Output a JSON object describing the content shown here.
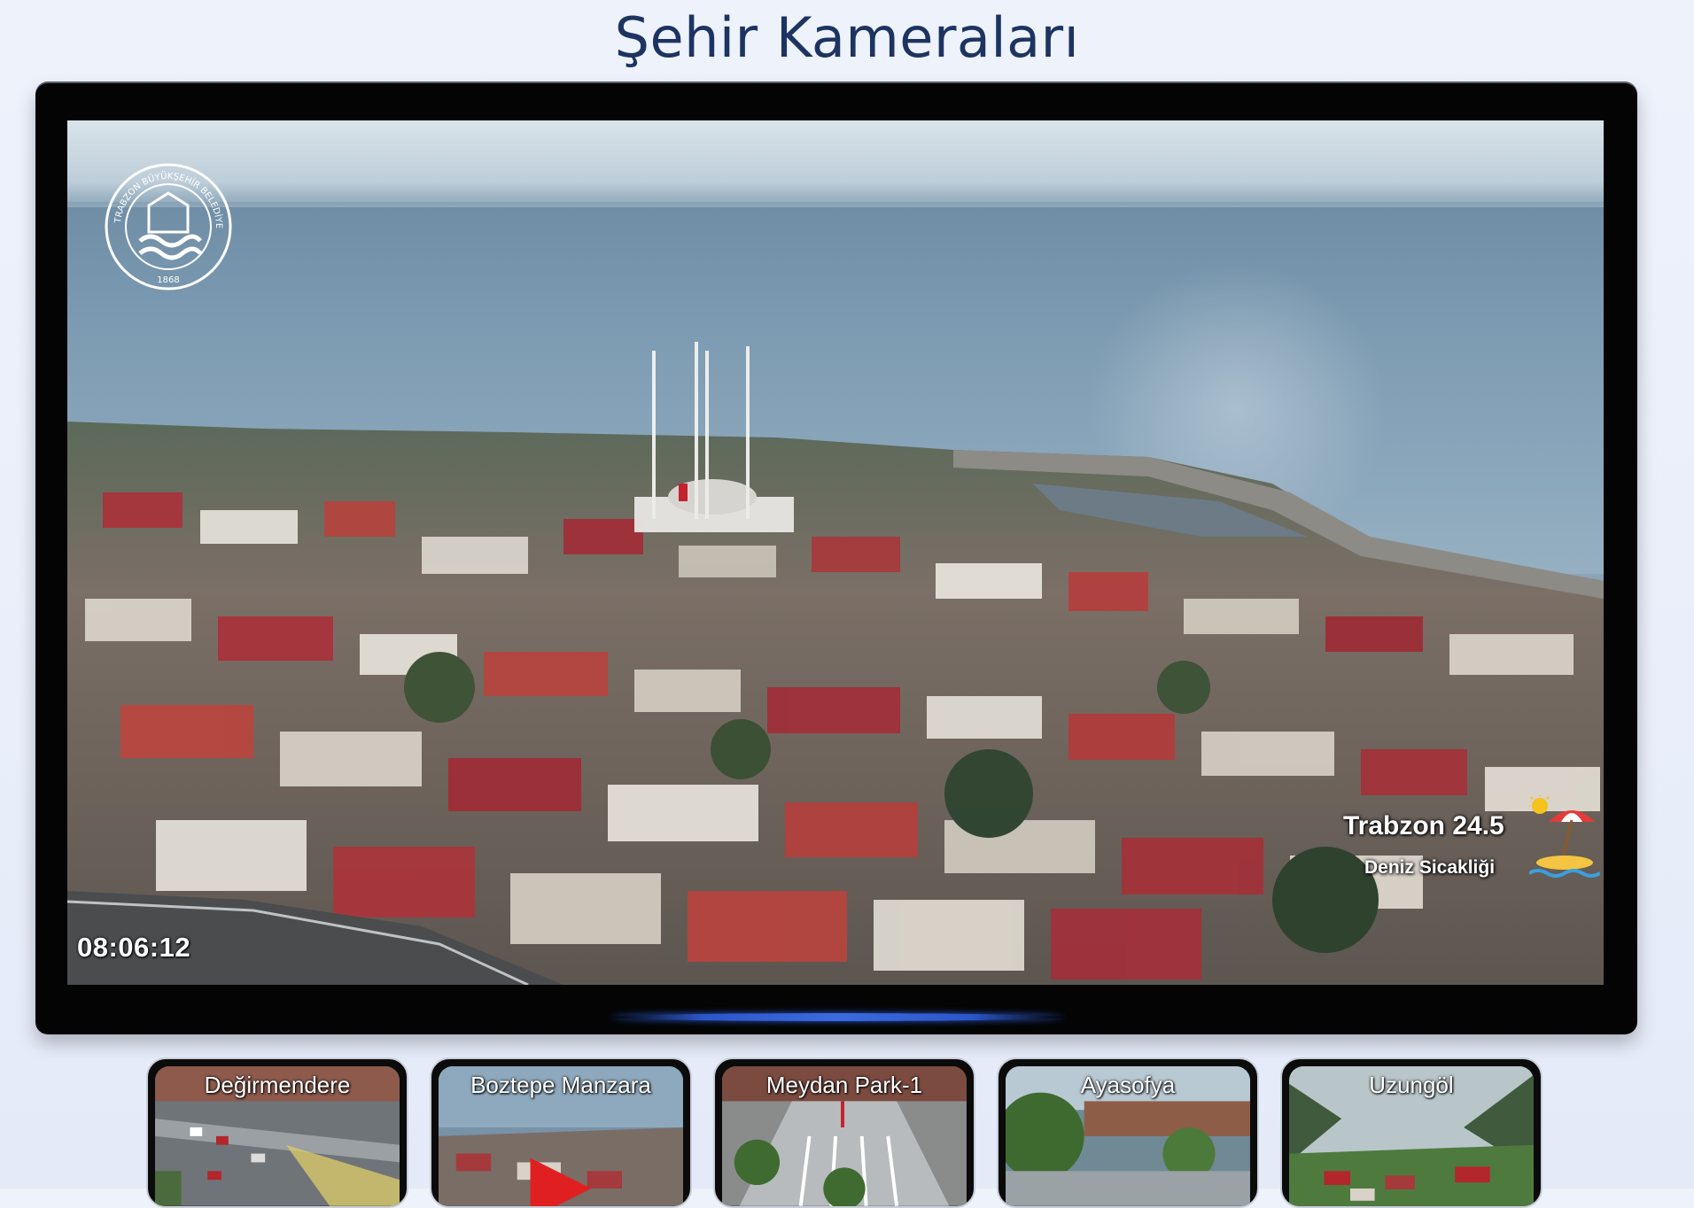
{
  "page": {
    "title": "Şehir Kameraları"
  },
  "player": {
    "timestamp": "08:06:12",
    "logo_text": "TRABZON BÜYÜKŞEHİR BELEDİYESİ",
    "logo_year": "1868",
    "weather": {
      "city_and_temp": "Trabzon  24.5",
      "label": "Deniz Sicakliği"
    }
  },
  "thumbnails": [
    {
      "label": "Değirmendere"
    },
    {
      "label": "Boztepe Manzara"
    },
    {
      "label": "Meydan Park-1"
    },
    {
      "label": "Ayasofya"
    },
    {
      "label": "Uzungöl"
    }
  ],
  "colors": {
    "title": "#1d3461",
    "tv_frame": "#040404",
    "stand_light": "#2b56c8"
  }
}
